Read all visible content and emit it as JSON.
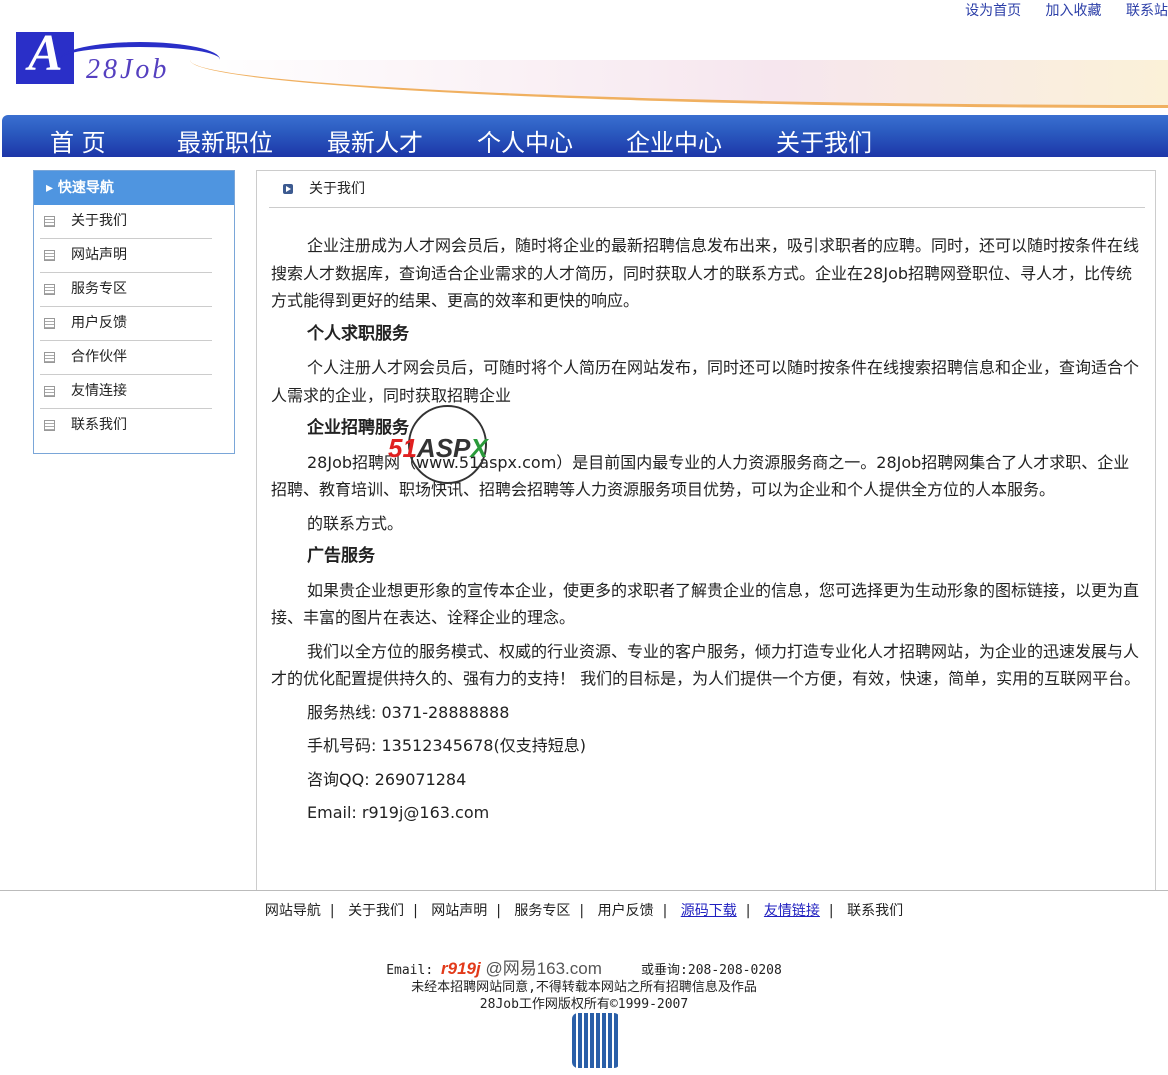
{
  "top_links": [
    "设为首页",
    "加入收藏",
    "联系站"
  ],
  "logo": {
    "text": "28Job"
  },
  "nav": [
    "首 页",
    "最新职位",
    "最新人才",
    "个人中心",
    "企业中心",
    "关于我们"
  ],
  "sidebar": {
    "title": "快速导航",
    "items": [
      "关于我们",
      "网站声明",
      "服务专区",
      "用户反馈",
      "合作伙伴",
      "友情连接",
      "联系我们"
    ]
  },
  "content": {
    "title": "关于我们",
    "p1": "企业注册成为人才网会员后，随时将企业的最新招聘信息发布出来，吸引求职者的应聘。同时，还可以随时按条件在线搜索人才数据库，查询适合企业需求的人才简历，同时获取人才的联系方式。企业在28Job招聘网登职位、寻人才，比传统方式能得到更好的结果、更高的效率和更快的响应。",
    "h1": "个人求职服务",
    "p2": "个人注册人才网会员后，可随时将个人简历在网站发布，同时还可以随时按条件在线搜索招聘信息和企业，查询适合个人需求的企业，同时获取招聘企业",
    "h2": "企业招聘服务",
    "p3": "28Job招聘网（www.51aspx.com）是目前国内最专业的人力资源服务商之一。28Job招聘网集合了人才求职、企业招聘、教育培训、职场快讯、招聘会招聘等人力资源服务项目优势，可以为企业和个人提供全方位的人本服务。",
    "p4": "的联系方式。",
    "h3": "广告服务",
    "p5": "如果贵企业想更形象的宣传本企业，使更多的求职者了解贵企业的信息，您可选择更为生动形象的图标链接，以更为直接、丰富的图片在表达、诠释企业的理念。",
    "p6": "我们以全方位的服务模式、权威的行业资源、专业的客户服务，倾力打造专业化人才招聘网站，为企业的迅速发展与人才的优化配置提供持久的、强有力的支持！ 我们的目标是，为人们提供一个方便，有效，快速，简单，实用的互联网平台。",
    "hotline": "服务热线: 0371-28888888",
    "mobile": "手机号码: 13512345678(仅支持短息)",
    "qq": "咨询QQ: 269071284",
    "email": "Email: r919j@163.com"
  },
  "watermark": {
    "brand": "51Aspx"
  },
  "footer_nav": [
    "网站导航",
    "关于我们",
    "网站声明",
    "服务专区",
    "用户反馈",
    "源码下载",
    "友情链接",
    "联系我们"
  ],
  "footer": {
    "email_label": "Email:",
    "email_user": "r919j",
    "email_domain": "@网易163.com",
    "phone": "或垂询:208-208-0208",
    "notice": "未经本招聘网站同意,不得转载本网站之所有招聘信息及作品",
    "copyright": "28Job工作网版权所有©1999-2007"
  }
}
